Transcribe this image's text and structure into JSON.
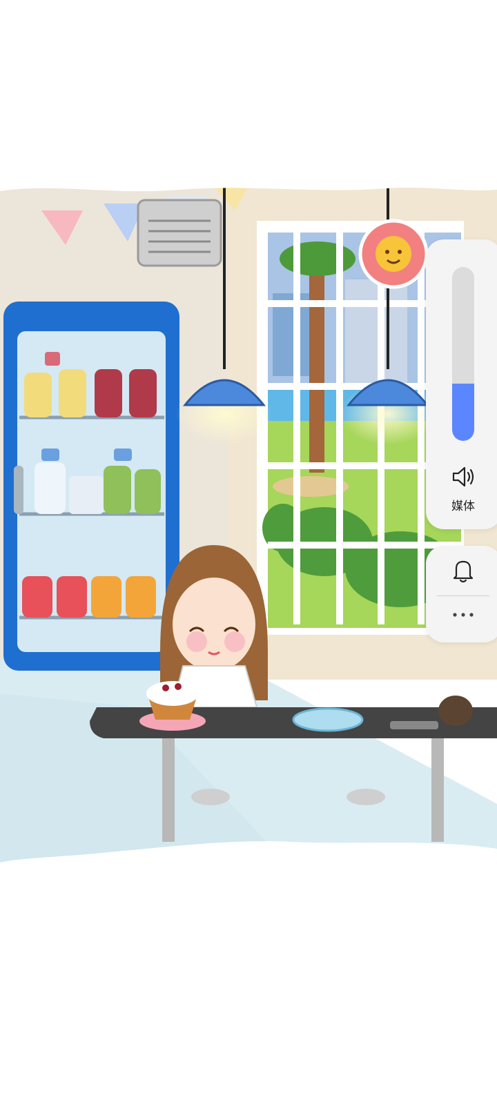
{
  "volume_panel": {
    "level": 0.33,
    "media_label": "媒体",
    "accent_color": "#5b86ff",
    "icons": [
      "speaker-icon",
      "bell-icon",
      "more-options-icon"
    ]
  },
  "scene": {
    "description_icons": [
      "cafe-scene-illustration",
      "avatar-badge-icon"
    ]
  }
}
